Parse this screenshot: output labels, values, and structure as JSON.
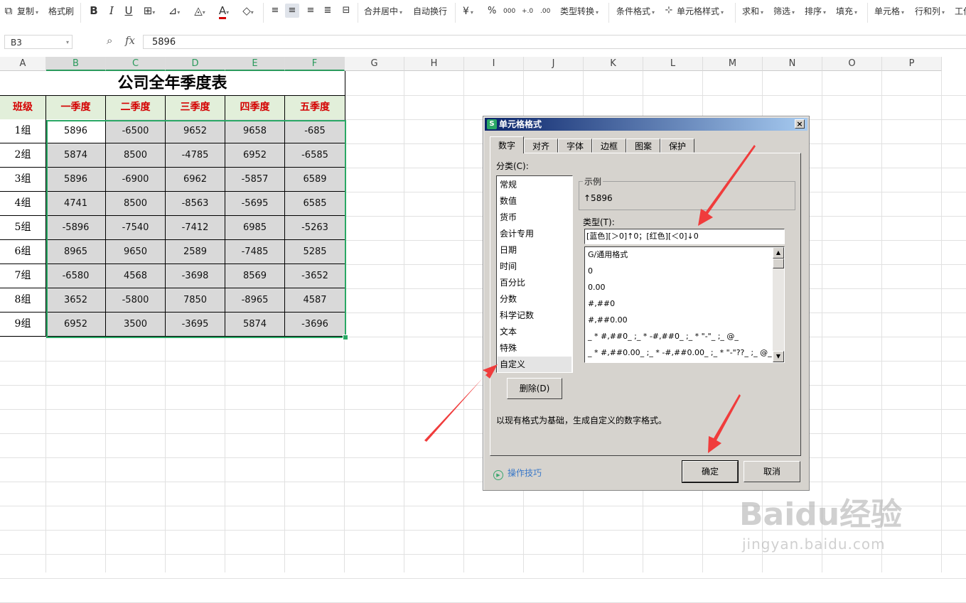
{
  "toolbar": {
    "copy": "复制",
    "format_painter": "格式刷",
    "bold": "B",
    "italic": "I",
    "underline": "U",
    "merge_center": "合并居中",
    "wrap_text": "自动换行",
    "currency": "¥",
    "percent": "%",
    "thousands": "000",
    "inc_decimal": "+.0",
    "dec_decimal": ".00",
    "type_convert": "类型转换",
    "cond_format": "条件格式",
    "cell_style": "单元格样式",
    "sum": "求和",
    "filter": "筛选",
    "sort": "排序",
    "fill": "填充",
    "cell": "单元格",
    "row_col": "行和列",
    "worksheet": "工作"
  },
  "formula_bar": {
    "name_box": "B3",
    "fx": "fx",
    "value": "5896"
  },
  "columns": [
    "A",
    "B",
    "C",
    "D",
    "E",
    "F",
    "G",
    "H",
    "I",
    "J",
    "K",
    "L",
    "M",
    "N",
    "O",
    "P"
  ],
  "sheet": {
    "title": "公司全年季度表",
    "headers": [
      "班级",
      "一季度",
      "二季度",
      "三季度",
      "四季度",
      "五季度"
    ],
    "rows": [
      {
        "label": "1组",
        "values": [
          "5896",
          "-6500",
          "9652",
          "9658",
          "-685"
        ]
      },
      {
        "label": "2组",
        "values": [
          "5874",
          "8500",
          "-4785",
          "6952",
          "-6585"
        ]
      },
      {
        "label": "3组",
        "values": [
          "5896",
          "-6900",
          "6962",
          "-5857",
          "6589"
        ]
      },
      {
        "label": "4组",
        "values": [
          "4741",
          "8500",
          "-8563",
          "-5695",
          "6585"
        ]
      },
      {
        "label": "5组",
        "values": [
          "-5896",
          "-7540",
          "-7412",
          "6985",
          "-5263"
        ]
      },
      {
        "label": "6组",
        "values": [
          "8965",
          "9650",
          "2589",
          "-7485",
          "5285"
        ]
      },
      {
        "label": "7组",
        "values": [
          "-6580",
          "4568",
          "-3698",
          "8569",
          "-3652"
        ]
      },
      {
        "label": "8组",
        "values": [
          "3652",
          "-5800",
          "7850",
          "-8965",
          "4587"
        ]
      },
      {
        "label": "9组",
        "values": [
          "6952",
          "3500",
          "-3695",
          "5874",
          "-3696"
        ]
      }
    ]
  },
  "dialog": {
    "title": "单元格格式",
    "logo": "S",
    "close": "×",
    "tabs": [
      "数字",
      "对齐",
      "字体",
      "边框",
      "图案",
      "保护"
    ],
    "category_label": "分类(C):",
    "categories": [
      "常规",
      "数值",
      "货币",
      "会计专用",
      "日期",
      "时间",
      "百分比",
      "分数",
      "科学记数",
      "文本",
      "特殊",
      "自定义"
    ],
    "sample_label": "示例",
    "sample_value": "↑5896",
    "type_label": "类型(T):",
    "type_value": "[蓝色][＞0]↑0；[红色][＜0]↓0",
    "formats": [
      "G/通用格式",
      "0",
      "0.00",
      "#,##0",
      "#,##0.00",
      "_ * #,##0_ ;_ * -#,##0_ ;_ * \"-\"_ ;_ @_",
      "_ * #,##0.00_ ;_ * -#,##0.00_ ;_ * \"-\"??_ ;_ @_"
    ],
    "delete_button": "删除(D)",
    "description": "以现有格式为基础，生成自定义的数字格式。",
    "tips": "操作技巧",
    "ok": "确定",
    "cancel": "取消"
  },
  "watermark": {
    "logo": "Baidu经验",
    "url": "jingyan.baidu.com"
  },
  "colors": {
    "accent_green": "#2aa865",
    "header_fill": "#e2efda",
    "header_text": "#d40000",
    "data_fill": "#d9d9d9",
    "arrow": "#f03c3c"
  }
}
